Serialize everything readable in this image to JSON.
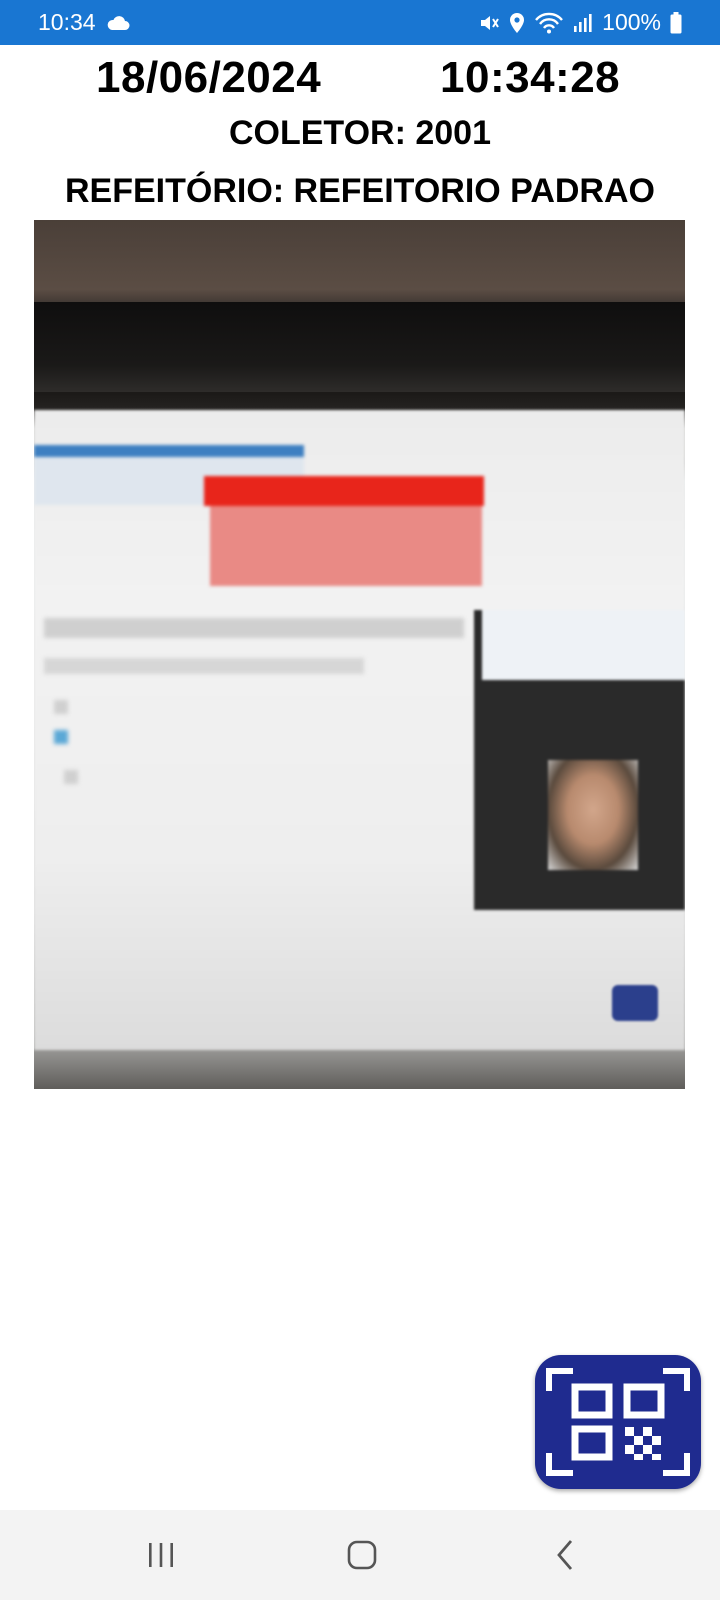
{
  "status_bar": {
    "time": "10:34",
    "battery": "100%",
    "icons": [
      "cloud-icon",
      "mute-icon",
      "location-icon",
      "wifi-icon",
      "signal-icon",
      "battery-icon"
    ],
    "background_color": "#1976d2"
  },
  "header": {
    "date": "18/06/2024",
    "time": "10:34:28",
    "collector": "COLETOR: 2001",
    "cafeteria": "REFEITÓRIO: REFEITORIO PADRAO"
  },
  "camera": {
    "icon": "camera-preview"
  },
  "qr_button": {
    "icon": "qr-scan-icon",
    "background_color": "#1f2b8f"
  },
  "navigation": {
    "icons": [
      "recent-apps-icon",
      "home-icon",
      "back-icon"
    ]
  }
}
